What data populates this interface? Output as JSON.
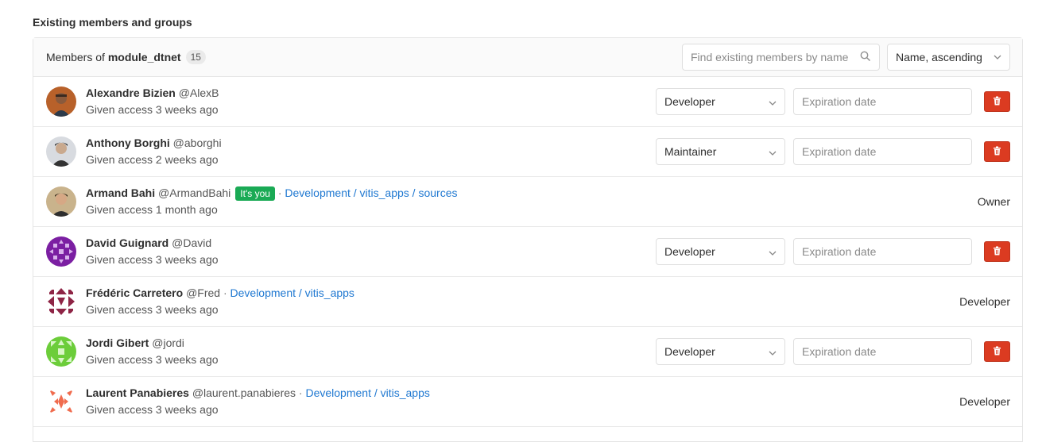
{
  "section_title": "Existing members and groups",
  "panel": {
    "prefix": "Members of",
    "project": "module_dtnet",
    "count": "15",
    "search_placeholder": "Find existing members by name",
    "sort_label": "Name, ascending"
  },
  "expiration_placeholder": "Expiration date",
  "members": [
    {
      "name": "Alexandre Bizien",
      "username": "@AlexB",
      "access": "Given access 3 weeks ago",
      "role": "Developer",
      "editable": true,
      "avatar": "photo-orange"
    },
    {
      "name": "Anthony Borghi",
      "username": "@aborghi",
      "access": "Given access 2 weeks ago",
      "role": "Maintainer",
      "editable": true,
      "avatar": "photo-gray"
    },
    {
      "name": "Armand Bahi",
      "username": "@ArmandBahi",
      "you": "It's you",
      "group": "Development / vitis_apps / sources",
      "access": "Given access 1 month ago",
      "role": "Owner",
      "editable": false,
      "avatar": "photo-tan"
    },
    {
      "name": "David Guignard",
      "username": "@David",
      "access": "Given access 3 weeks ago",
      "role": "Developer",
      "editable": true,
      "avatar": "identicon-purple"
    },
    {
      "name": "Frédéric Carretero",
      "username": "@Fred",
      "group": "Development / vitis_apps",
      "access": "Given access 3 weeks ago",
      "role": "Developer",
      "editable": false,
      "avatar": "identicon-maroon"
    },
    {
      "name": "Jordi Gibert",
      "username": "@jordi",
      "access": "Given access 3 weeks ago",
      "role": "Developer",
      "editable": true,
      "avatar": "identicon-green"
    },
    {
      "name": "Laurent Panabieres",
      "username": "@laurent.panabieres",
      "group": "Development / vitis_apps",
      "access": "Given access 3 weeks ago",
      "role": "Developer",
      "editable": false,
      "avatar": "identicon-coral"
    }
  ],
  "colors": {
    "delete": "#db3b21",
    "you_badge": "#1aaa55",
    "link": "#1f78d1"
  }
}
